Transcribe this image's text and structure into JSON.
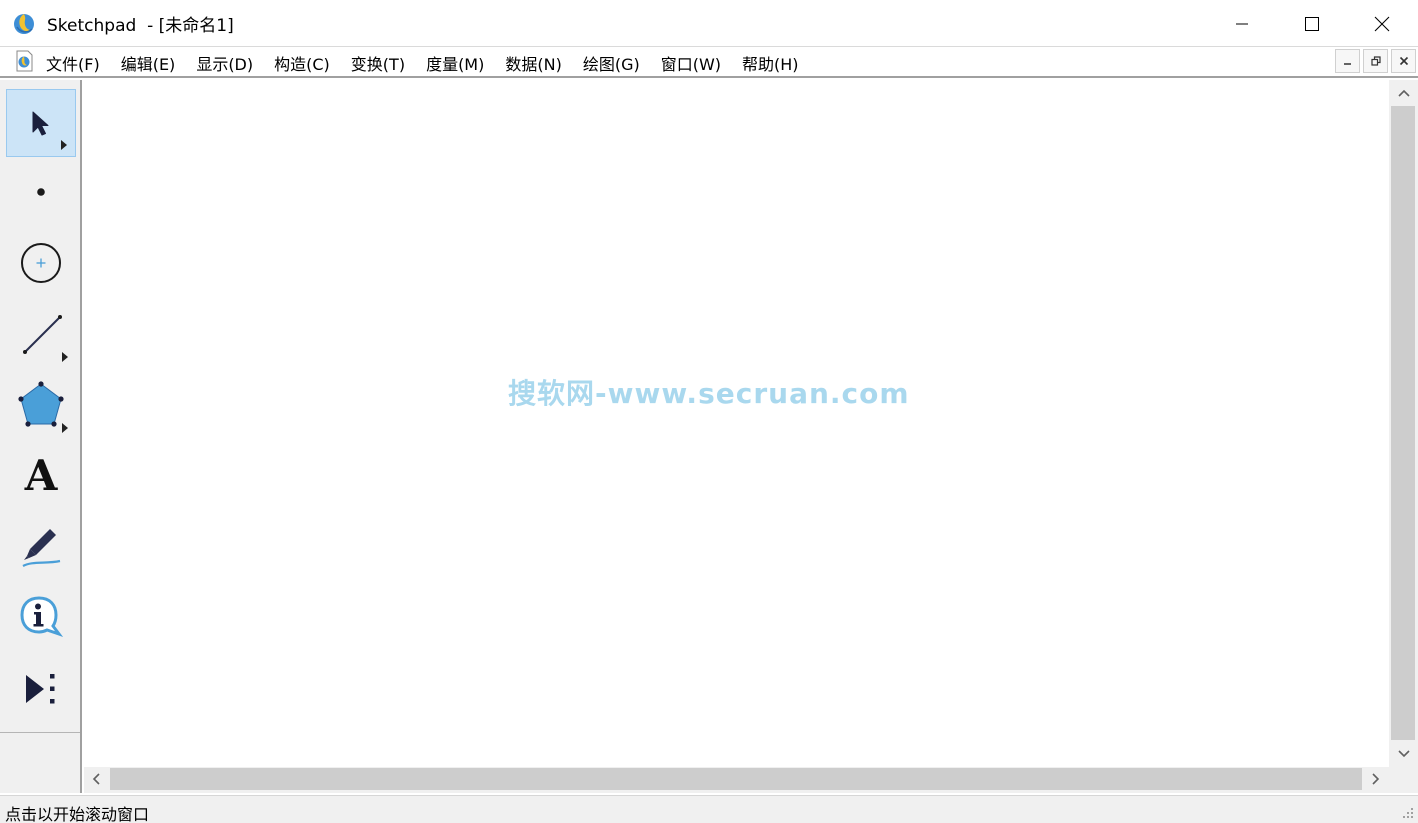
{
  "window": {
    "title": "Sketchpad  - [未命名1]"
  },
  "menu": {
    "items": [
      {
        "label": "文件(F)"
      },
      {
        "label": "编辑(E)"
      },
      {
        "label": "显示(D)"
      },
      {
        "label": "构造(C)"
      },
      {
        "label": "变换(T)"
      },
      {
        "label": "度量(M)"
      },
      {
        "label": "数据(N)"
      },
      {
        "label": "绘图(G)"
      },
      {
        "label": "窗口(W)"
      },
      {
        "label": "帮助(H)"
      }
    ]
  },
  "toolbox": {
    "tools": [
      {
        "name": "selection-arrow-tool",
        "icon": "arrow-pointer-icon",
        "active": true,
        "submenu": true
      },
      {
        "name": "point-tool",
        "icon": "point-icon",
        "active": false,
        "submenu": false
      },
      {
        "name": "compass-tool",
        "icon": "circle-icon",
        "active": false,
        "submenu": false
      },
      {
        "name": "straightedge-tool",
        "icon": "line-segment-icon",
        "active": false,
        "submenu": true
      },
      {
        "name": "polygon-tool",
        "icon": "pentagon-icon",
        "active": false,
        "submenu": true
      },
      {
        "name": "text-tool",
        "icon": "text-a-icon",
        "active": false,
        "submenu": false
      },
      {
        "name": "marker-tool",
        "icon": "marker-pen-icon",
        "active": false,
        "submenu": false
      },
      {
        "name": "information-tool",
        "icon": "info-bubble-icon",
        "active": false,
        "submenu": false
      },
      {
        "name": "custom-tool",
        "icon": "play-menu-icon",
        "active": false,
        "submenu": false
      }
    ],
    "text_tool_glyph": "A"
  },
  "canvas": {
    "watermark": "搜软网-www.secruan.com"
  },
  "statusbar": {
    "text": "点击以开始滚动窗口"
  },
  "colors": {
    "accent": "#cce4f7",
    "tool_blue": "#4a9fd8",
    "scrollbar_thumb": "#cdcdcd",
    "watermark": "#a9d8ee"
  }
}
